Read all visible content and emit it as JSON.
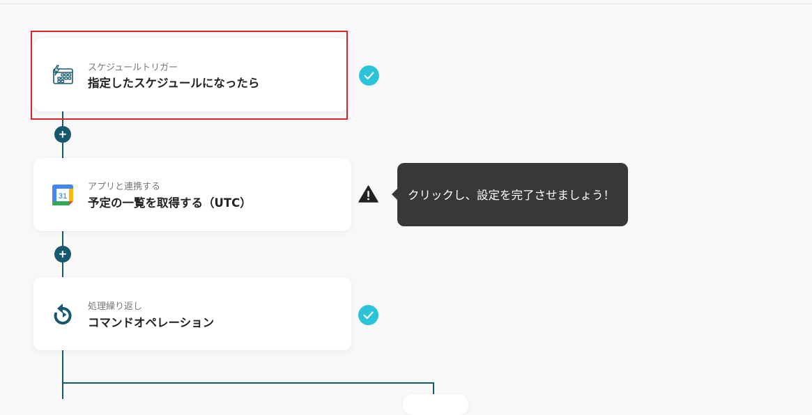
{
  "flow": {
    "steps": [
      {
        "subtitle": "スケジュールトリガー",
        "title": "指定したスケジュールになったら",
        "icon": "schedule-trigger-icon",
        "status": "complete"
      },
      {
        "subtitle": "アプリと連携する",
        "title": "予定の一覧を取得する（UTC）",
        "icon": "google-calendar-icon",
        "calendar_day": "31",
        "status": "warning"
      },
      {
        "subtitle": "処理繰り返し",
        "title": "コマンドオペレーション",
        "icon": "loop-icon",
        "status": "complete"
      }
    ]
  },
  "tooltip": {
    "text": "クリックし、設定を完了させましょう！"
  },
  "colors": {
    "line": "#16586e",
    "check": "#2bc3d8",
    "selected_outline": "#e0242a",
    "tooltip_bg": "#383838",
    "warning": "#222222"
  }
}
